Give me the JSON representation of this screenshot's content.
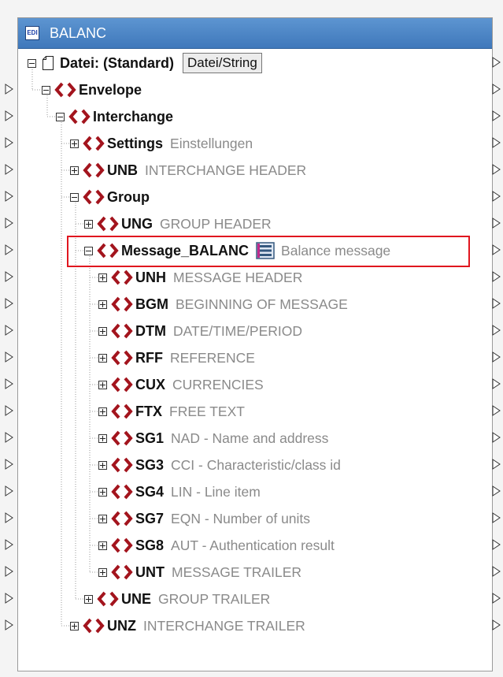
{
  "component": {
    "icon_label": "EDI",
    "title": "BALANC"
  },
  "root": {
    "name": "Datei: (Standard)",
    "button_label": "Datei/String"
  },
  "tree": [
    {
      "name": "Envelope",
      "desc": ""
    },
    {
      "name": "Interchange",
      "desc": ""
    },
    {
      "name": "Settings",
      "desc": "Einstellungen"
    },
    {
      "name": "UNB",
      "desc": "INTERCHANGE HEADER"
    },
    {
      "name": "Group",
      "desc": ""
    },
    {
      "name": "UNG",
      "desc": "GROUP HEADER"
    },
    {
      "name": "Message_BALANC",
      "desc": "Balance message"
    },
    {
      "name": "UNH",
      "desc": "MESSAGE HEADER"
    },
    {
      "name": "BGM",
      "desc": "BEGINNING OF MESSAGE"
    },
    {
      "name": "DTM",
      "desc": "DATE/TIME/PERIOD"
    },
    {
      "name": "RFF",
      "desc": "REFERENCE"
    },
    {
      "name": "CUX",
      "desc": "CURRENCIES"
    },
    {
      "name": "FTX",
      "desc": "FREE TEXT"
    },
    {
      "name": "SG1",
      "desc": "NAD - Name and address"
    },
    {
      "name": "SG3",
      "desc": "CCI - Characteristic/class id"
    },
    {
      "name": "SG4",
      "desc": "LIN - Line item"
    },
    {
      "name": "SG7",
      "desc": "EQN - Number of units"
    },
    {
      "name": "SG8",
      "desc": "AUT - Authentication result"
    },
    {
      "name": "UNT",
      "desc": "MESSAGE TRAILER"
    },
    {
      "name": "UNE",
      "desc": "GROUP TRAILER"
    },
    {
      "name": "UNZ",
      "desc": "INTERCHANGE TRAILER"
    }
  ],
  "colors": {
    "title_bar": "#4a86c8",
    "element_icon": "#a3141d",
    "highlight_border": "#e0161f"
  }
}
